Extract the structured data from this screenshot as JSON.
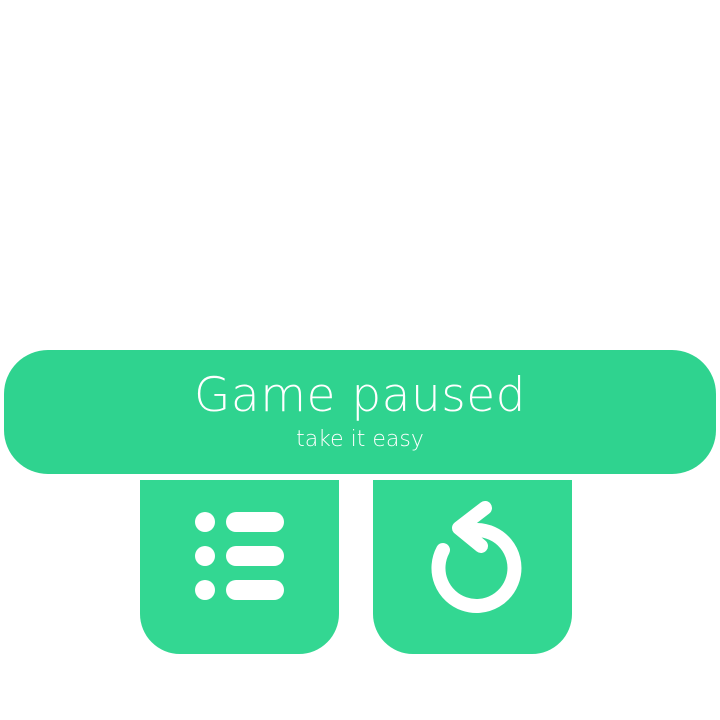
{
  "pause_panel": {
    "title": "Game paused",
    "subtitle": "take it easy"
  },
  "buttons": {
    "menu_icon": "list-icon",
    "restart_icon": "restart-icon"
  },
  "colors": {
    "banner": "#2fd38f",
    "button": "#33d792",
    "icon": "#ffffff",
    "background": "#ffffff"
  }
}
